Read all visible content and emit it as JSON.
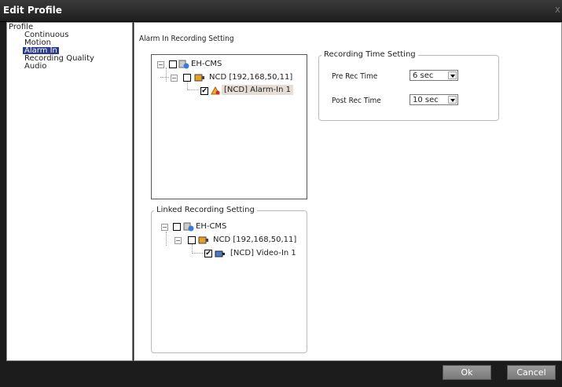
{
  "window": {
    "title": "Edit Profile",
    "close_label": "x"
  },
  "sidebar": {
    "root": "Profile",
    "items": [
      {
        "label": "Continuous"
      },
      {
        "label": "Motion"
      },
      {
        "label": "Alarm In",
        "selected": true
      },
      {
        "label": "Recording Quality"
      },
      {
        "label": "Audio"
      }
    ]
  },
  "alarm": {
    "heading": "Alarm In Recording Setting",
    "tree": {
      "root": "EH-CMS",
      "device": "NCD [192,168,50,11]",
      "channel": "[NCD] Alarm-In 1",
      "channel_checked": true
    }
  },
  "linked": {
    "heading": "Linked Recording Setting",
    "tree": {
      "root": "EH-CMS",
      "device": "NCD [192,168,50,11]",
      "channel": "[NCD] Video-In 1",
      "channel_checked": true
    }
  },
  "recording_time": {
    "heading": "Recording Time Setting",
    "pre_label": "Pre Rec Time",
    "pre_value": "6 sec",
    "post_label": "Post Rec Time",
    "post_value": "10 sec"
  },
  "footer": {
    "ok": "Ok",
    "cancel": "Cancel"
  },
  "colors": {
    "selection": "#2b3a8c",
    "frame": "#1c1c1c"
  }
}
